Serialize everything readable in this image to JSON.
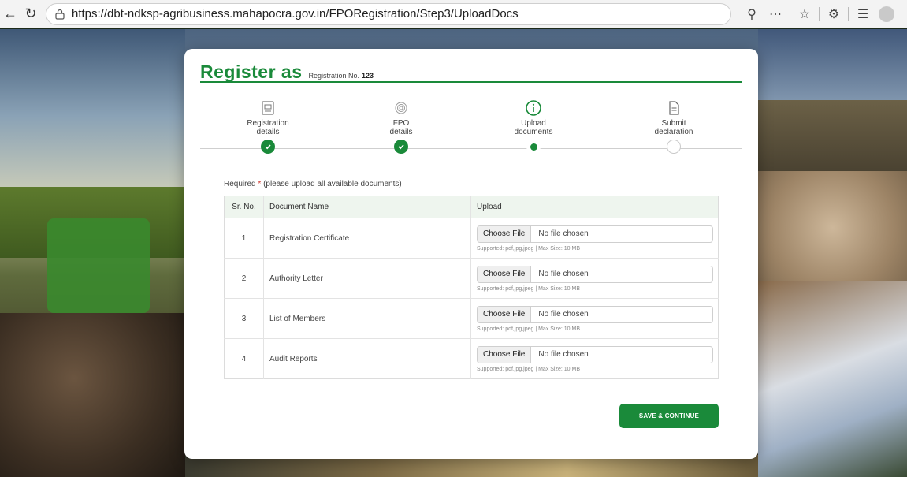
{
  "browser": {
    "url": "https://dbt-ndksp-agribusiness.mahapocra.gov.in/FPORegistration/Step3/UploadDocs",
    "icons": [
      "back-icon",
      "refresh-icon",
      "lock-icon",
      "zoom-out-icon",
      "more-icon",
      "favorite-icon",
      "extensions-icon",
      "collections-icon",
      "profile-icon"
    ]
  },
  "header": {
    "title": "Register as",
    "registration_label": "Registration No.",
    "registration_number": "123"
  },
  "stepper": {
    "steps": [
      {
        "line1": "Registration",
        "line2": "details",
        "status": "done",
        "icon": "id-card-icon"
      },
      {
        "line1": "FPO",
        "line2": "details",
        "status": "done",
        "icon": "fingerprint-icon"
      },
      {
        "line1": "Upload",
        "line2": "documents",
        "status": "active",
        "icon": "info-icon"
      },
      {
        "line1": "Submit",
        "line2": "declaration",
        "status": "pending",
        "icon": "document-icon"
      }
    ]
  },
  "required": {
    "prefix": "Required",
    "star": "*",
    "note": "(please upload all available documents)"
  },
  "table": {
    "headers": [
      "Sr. No.",
      "Document Name",
      "Upload"
    ],
    "rows": [
      {
        "sr": "1",
        "name": "Registration Certificate",
        "button": "Choose File",
        "status": "No file chosen",
        "hint": "Supported: pdf,jpg,jpeg | Max Size: 10 MB"
      },
      {
        "sr": "2",
        "name": "Authority Letter",
        "button": "Choose File",
        "status": "No file chosen",
        "hint": "Supported: pdf,jpg,jpeg | Max Size: 10 MB"
      },
      {
        "sr": "3",
        "name": "List of Members",
        "button": "Choose File",
        "status": "No file chosen",
        "hint": "Supported: pdf,jpg,jpeg | Max Size: 10 MB"
      },
      {
        "sr": "4",
        "name": "Audit Reports",
        "button": "Choose File",
        "status": "No file chosen",
        "hint": "Supported: pdf,jpg,jpeg | Max Size: 10 MB"
      }
    ]
  },
  "actions": {
    "save_label": "SAVE & CONTINUE"
  },
  "colors": {
    "brand_green": "#1a8a3a",
    "required_star": "#d0342c"
  }
}
